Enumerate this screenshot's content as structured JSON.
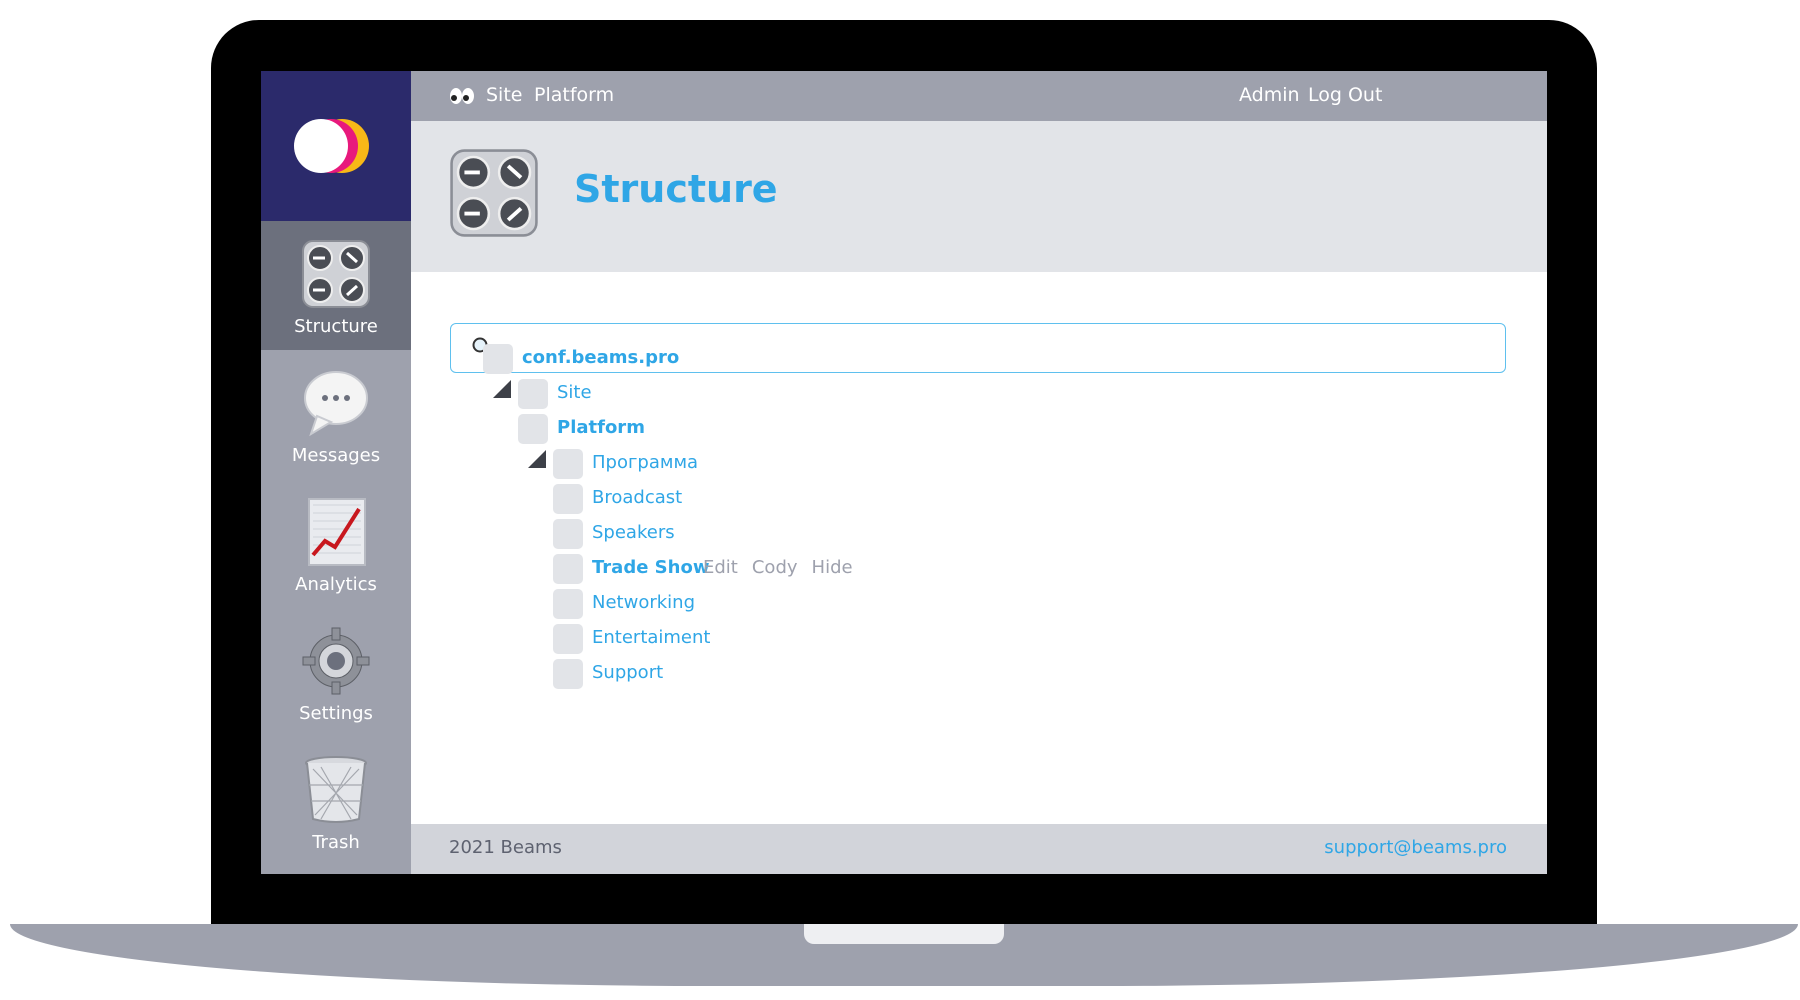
{
  "brand": {
    "logo_colors": [
      "#ffffff",
      "#e8197c",
      "#f8b817"
    ],
    "logo_bg": "#2b2a6b"
  },
  "sidebar": {
    "items": [
      {
        "label": "Structure",
        "icon": "knobs-icon",
        "active": true
      },
      {
        "label": "Messages",
        "icon": "speech-bubble-icon",
        "active": false
      },
      {
        "label": "Analytics",
        "icon": "chart-icon",
        "active": false
      },
      {
        "label": "Settings",
        "icon": "gear-icon",
        "active": false
      },
      {
        "label": "Trash",
        "icon": "trash-icon",
        "active": false
      }
    ]
  },
  "topbar": {
    "left_links": [
      "Site",
      "Platform"
    ],
    "right_links": [
      "Admin",
      "Log Out"
    ],
    "eyes_icon": "eyes-icon"
  },
  "header": {
    "title": "Structure",
    "icon": "knobs-icon"
  },
  "search": {
    "placeholder": "",
    "value": "",
    "icon": "search-icon"
  },
  "tree": {
    "root": "conf.beams.pro",
    "items": [
      {
        "label": "Site"
      },
      {
        "label": "Platform"
      },
      {
        "label": "Программа"
      },
      {
        "label": "Broadcast"
      },
      {
        "label": "Speakers"
      },
      {
        "label": "Trade Show"
      },
      {
        "label": "Networking"
      },
      {
        "label": "Entertaiment"
      },
      {
        "label": "Support"
      }
    ],
    "row_actions": [
      "Edit",
      "Cody",
      "Hide"
    ]
  },
  "footer": {
    "copyright": "2021 Beams",
    "email": "support@beams.pro"
  },
  "colors": {
    "accent": "#2fa6e6",
    "sidebar": "#9ea1ad",
    "sidebar_active": "#6c707d"
  }
}
